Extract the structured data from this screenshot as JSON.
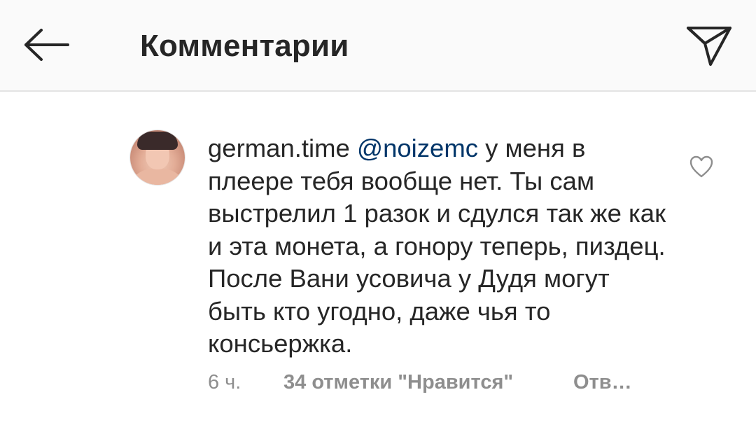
{
  "header": {
    "title": "Комментарии",
    "back_icon": "arrow-left-icon",
    "share_icon": "paper-plane-icon"
  },
  "comment": {
    "username": "german.time",
    "mention": "@noizemc",
    "text": " у меня в плеере тебя вообще нет. Ты сам выстрелил 1 разок и сдулся так же как и эта монета, а гонору теперь, пиздец. После Вани усовича у Дудя могут быть кто угодно, даже чья то консьержка.",
    "time": "6 ч.",
    "likes": "34 отметки \"Нравится\"",
    "reply": "Отв…",
    "like_icon": "heart-outline-icon"
  },
  "colors": {
    "header_bg": "#fafafa",
    "text": "#262626",
    "mention": "#003569",
    "meta": "#8e8e8e"
  }
}
